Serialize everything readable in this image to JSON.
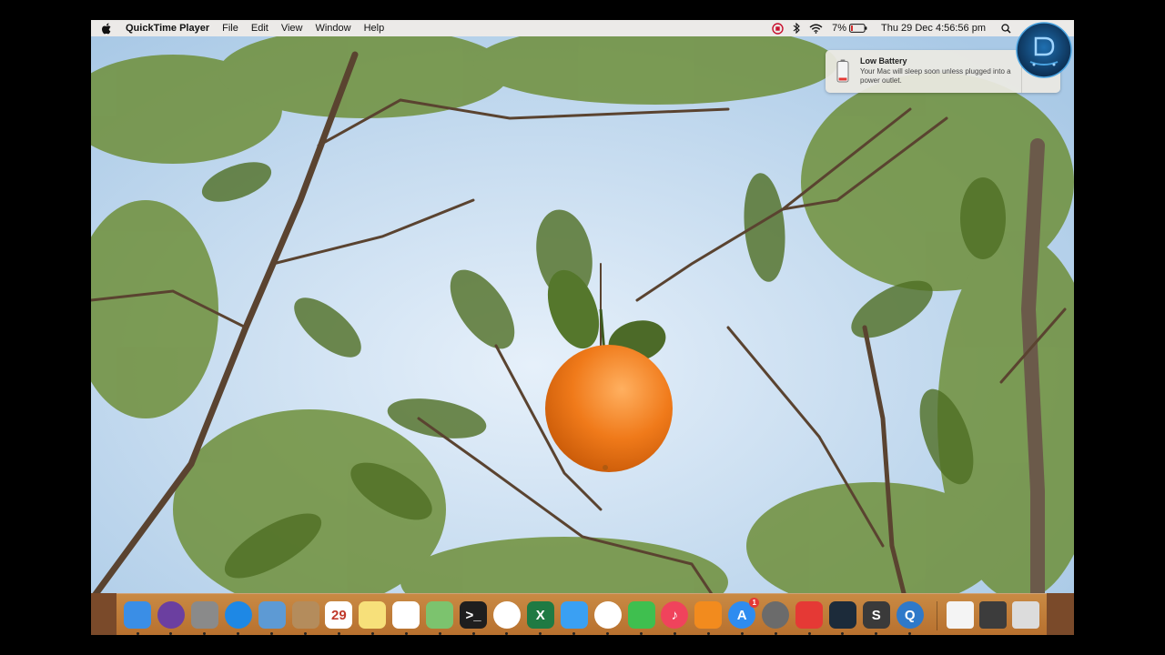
{
  "menubar": {
    "app_name": "QuickTime Player",
    "menus": [
      "File",
      "Edit",
      "View",
      "Window",
      "Help"
    ],
    "battery_percent": "7%",
    "datetime": "Thu 29 Dec  4:56:56 pm"
  },
  "notification": {
    "title": "Low Battery",
    "body": "Your Mac will sleep soon unless plugged into a power outlet."
  },
  "dock": {
    "apps": [
      {
        "name": "Finder",
        "icon": "finder-icon",
        "color": "#3a8ee6"
      },
      {
        "name": "Siri",
        "icon": "siri-icon",
        "color": "#6b3fa0"
      },
      {
        "name": "Launchpad",
        "icon": "launchpad-icon",
        "color": "#8a8a8a"
      },
      {
        "name": "Safari",
        "icon": "safari-icon",
        "color": "#1e88e5"
      },
      {
        "name": "Preview",
        "icon": "preview-icon",
        "color": "#5d9ad4"
      },
      {
        "name": "Contacts",
        "icon": "contacts-icon",
        "color": "#b48c5c"
      },
      {
        "name": "Calendar",
        "icon": "calendar-icon",
        "color": "#ffffff",
        "text": "29"
      },
      {
        "name": "Notes",
        "icon": "notes-icon",
        "color": "#f7e07a"
      },
      {
        "name": "Reminders",
        "icon": "reminders-icon",
        "color": "#ffffff"
      },
      {
        "name": "Maps",
        "icon": "maps-icon",
        "color": "#7cc36e"
      },
      {
        "name": "Terminal",
        "icon": "terminal-icon",
        "color": "#1e1e1e",
        "text": ">_"
      },
      {
        "name": "Photos",
        "icon": "photos-icon",
        "color": "#ffffff"
      },
      {
        "name": "Excel",
        "icon": "excel-icon",
        "color": "#1f7a43",
        "text": "X"
      },
      {
        "name": "Messages",
        "icon": "messages-icon",
        "color": "#3aa0f3"
      },
      {
        "name": "Chrome",
        "icon": "chrome-icon",
        "color": "#ffffff"
      },
      {
        "name": "FaceTime",
        "icon": "facetime-icon",
        "color": "#3fbf4f"
      },
      {
        "name": "Music",
        "icon": "music-icon",
        "color": "#f0435c",
        "text": "♪"
      },
      {
        "name": "Books",
        "icon": "books-icon",
        "color": "#f28b1e"
      },
      {
        "name": "App Store",
        "icon": "app-store-icon",
        "color": "#2e8cf0",
        "text": "A",
        "badge": "1"
      },
      {
        "name": "System Preferences",
        "icon": "system-preferences-icon",
        "color": "#6b6b6b"
      },
      {
        "name": "AnyDesk",
        "icon": "anydesk-icon",
        "color": "#e53935"
      },
      {
        "name": "Filmora",
        "icon": "filmora-icon",
        "color": "#1c2b3a"
      },
      {
        "name": "Sublime Text",
        "icon": "sublime-icon",
        "color": "#3a3a3a",
        "text": "S"
      },
      {
        "name": "QuickTime Player",
        "icon": "quicktime-icon",
        "color": "#2f79c9",
        "text": "Q"
      }
    ],
    "right_items": [
      {
        "name": "Document",
        "icon": "document-icon",
        "color": "#f4f4f4"
      },
      {
        "name": "Screenshot",
        "icon": "screenshot-icon",
        "color": "#3c3c3c"
      },
      {
        "name": "Trash",
        "icon": "trash-icon",
        "color": "#dcdcdc"
      }
    ]
  }
}
